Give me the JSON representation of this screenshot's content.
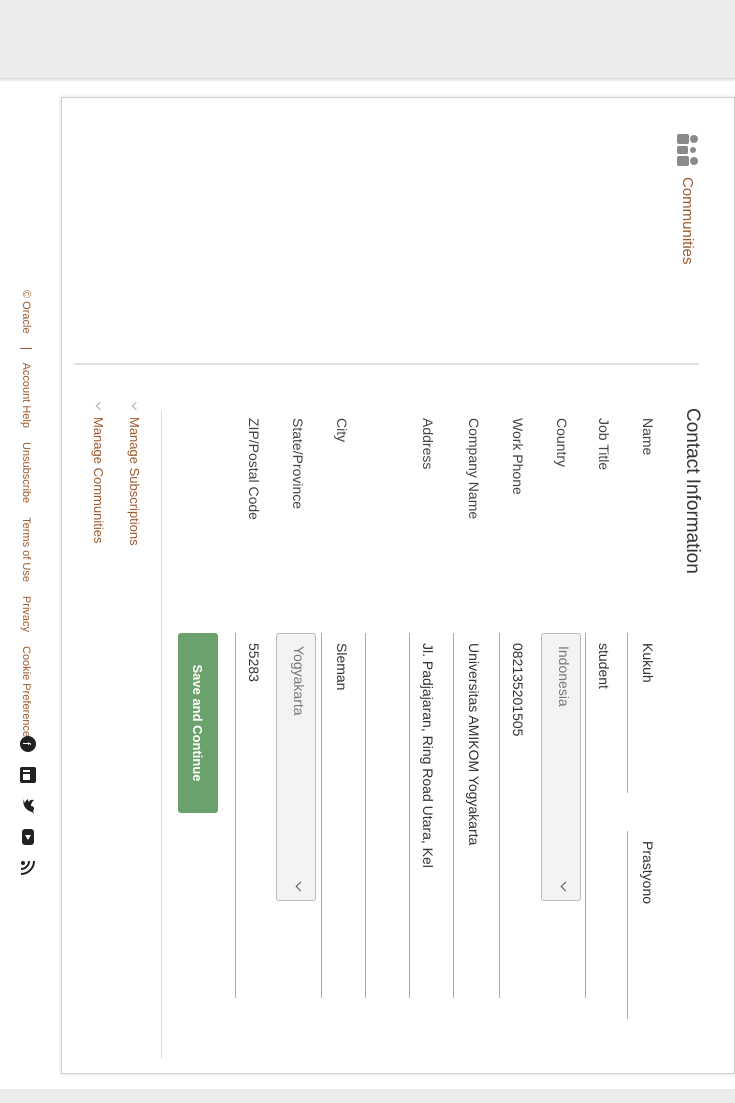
{
  "brand": {
    "name": "Communities"
  },
  "form": {
    "title": "Contact Information",
    "labels": {
      "name": "Name",
      "job_title": "Job Title",
      "country": "Country",
      "work_phone": "Work Phone",
      "company_name": "Company Name",
      "address": "Address",
      "city": "City",
      "state": "State/Province",
      "zip": "ZIP/Postal Code"
    },
    "values": {
      "first_name": "Kukuh",
      "last_name": "Prastyono",
      "job_title": "student",
      "country": "Indonesia",
      "work_phone": "082135201505",
      "company_name": "Universitas AMIKOM Yogyakarta",
      "address": "Jl. Padjajaran, Ring Road Utara, Kel",
      "city": "Sleman",
      "state": "Yogyakarta",
      "zip": "55283"
    },
    "submit_label": "Save and Continue"
  },
  "manage": {
    "subscriptions": "Manage Subscriptions",
    "communities": "Manage Communities"
  },
  "footer": {
    "copyright": "© Oracle",
    "links": [
      "Account Help",
      "Unsubscribe",
      "Terms of Use",
      "Privacy",
      "Cookie Preferences"
    ]
  },
  "social_icons": [
    "facebook-icon",
    "linkedin-icon",
    "twitter-icon",
    "youtube-icon",
    "rss-icon"
  ],
  "colors": {
    "accent": "#9c5a2e",
    "button": "#6ba16b"
  }
}
